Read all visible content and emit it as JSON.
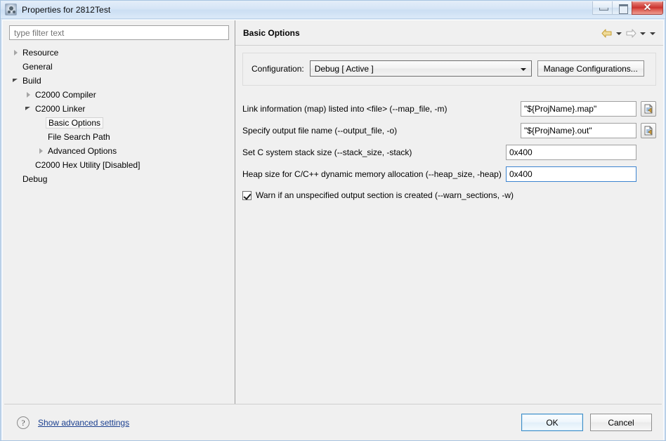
{
  "window": {
    "title": "Properties for 2812Test",
    "icon": "properties-icon",
    "minimize_label": "",
    "maximize_label": "",
    "close_label": "✕"
  },
  "filter": {
    "placeholder": "type filter text",
    "value": ""
  },
  "tree": {
    "items": [
      {
        "label": "Resource",
        "indent": 0,
        "twisty": "collapsed",
        "selected": false
      },
      {
        "label": "General",
        "indent": 0,
        "twisty": "none",
        "selected": false
      },
      {
        "label": "Build",
        "indent": 0,
        "twisty": "expanded",
        "selected": false
      },
      {
        "label": "C2000 Compiler",
        "indent": 1,
        "twisty": "collapsed",
        "selected": false
      },
      {
        "label": "C2000 Linker",
        "indent": 1,
        "twisty": "expanded",
        "selected": false
      },
      {
        "label": "Basic Options",
        "indent": 2,
        "twisty": "none",
        "selected": true
      },
      {
        "label": "File Search Path",
        "indent": 2,
        "twisty": "none",
        "selected": false
      },
      {
        "label": "Advanced Options",
        "indent": 2,
        "twisty": "collapsed",
        "selected": false
      },
      {
        "label": "C2000 Hex Utility  [Disabled]",
        "indent": 1,
        "twisty": "none",
        "selected": false
      },
      {
        "label": "Debug",
        "indent": 0,
        "twisty": "none",
        "selected": false
      }
    ]
  },
  "page": {
    "title": "Basic Options",
    "nav": {
      "back_icon": "back-arrow-icon",
      "back_menu_icon": "chevron-down-icon",
      "forward_icon": "forward-arrow-icon",
      "forward_menu_icon": "chevron-down-icon",
      "view_menu_icon": "chevron-down-icon"
    }
  },
  "configuration": {
    "label": "Configuration:",
    "selected": "Debug  [ Active ]",
    "options": [
      "Debug  [ Active ]"
    ],
    "manage_button": "Manage Configurations..."
  },
  "options": [
    {
      "label": "Link information (map) listed into <file> (--map_file, -m)",
      "value": "\"${ProjName}.map\"",
      "has_browse": true,
      "browse_icon": "variables-icon",
      "focused": false,
      "width": "narrow"
    },
    {
      "label": "Specify output file name (--output_file, -o)",
      "value": "\"${ProjName}.out\"",
      "has_browse": true,
      "browse_icon": "variables-icon",
      "focused": false,
      "width": "narrow"
    },
    {
      "label": "Set C system stack size (--stack_size, -stack)",
      "value": "0x400",
      "has_browse": false,
      "browse_icon": "",
      "focused": false,
      "width": "wide"
    },
    {
      "label": "Heap size for C/C++ dynamic memory allocation (--heap_size, -heap)",
      "value": "0x400",
      "has_browse": false,
      "browse_icon": "",
      "focused": true,
      "width": "wide"
    }
  ],
  "checkbox_option": {
    "label": "Warn if an unspecified output section is created (--warn_sections, -w)",
    "checked": true
  },
  "footer": {
    "help_icon": "question-mark-icon",
    "advanced_link": "Show advanced settings",
    "ok_label": "OK",
    "cancel_label": "Cancel"
  },
  "colors": {
    "accent": "#3c8dc8",
    "link": "#1a3f8f",
    "title_gradient_start": "#e4eef9",
    "close_button": "#c9302b",
    "dialog_bg": "#f0f0f0",
    "back_arrow": "#e8c75a"
  }
}
